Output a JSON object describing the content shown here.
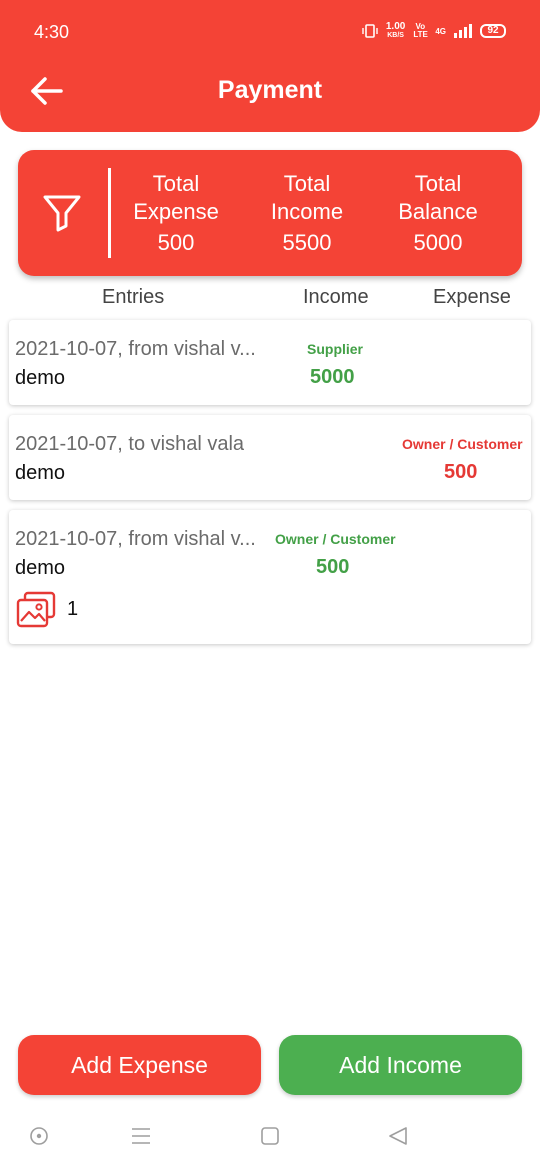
{
  "status_bar": {
    "time": "4:30",
    "speed_value": "1.00",
    "speed_unit": "KB/S",
    "volte": "Vo LTE",
    "network": "4G",
    "battery": "92"
  },
  "header": {
    "title": "Payment"
  },
  "summary": {
    "expense": {
      "label_1": "Total",
      "label_2": "Expense",
      "value": "500"
    },
    "income": {
      "label_1": "Total",
      "label_2": "Income",
      "value": "5500"
    },
    "balance": {
      "label_1": "Total",
      "label_2": "Balance",
      "value": "5000"
    }
  },
  "columns": {
    "entries": "Entries",
    "income": "Income",
    "expense": "Expense"
  },
  "entries": [
    {
      "description": "2021-10-07, from vishal v...",
      "note": "demo",
      "party_type": "Supplier",
      "amount": "5000",
      "column": "income"
    },
    {
      "description": "2021-10-07, to vishal vala",
      "note": "demo",
      "party_type": "Owner / Customer",
      "amount": "500",
      "column": "expense"
    },
    {
      "description": "2021-10-07, from vishal v...",
      "note": "demo",
      "party_type": "Owner / Customer",
      "amount": "500",
      "column": "income",
      "attachments": "1"
    }
  ],
  "buttons": {
    "add_expense": "Add Expense",
    "add_income": "Add Income"
  },
  "colors": {
    "primary_red": "#f44336",
    "income_green": "#43a047",
    "button_green": "#4caf50"
  },
  "icons": [
    "back-arrow-icon",
    "filter-icon",
    "image-gallery-icon",
    "nav-circle-icon",
    "nav-menu-icon",
    "nav-square-icon",
    "nav-back-triangle-icon"
  ]
}
